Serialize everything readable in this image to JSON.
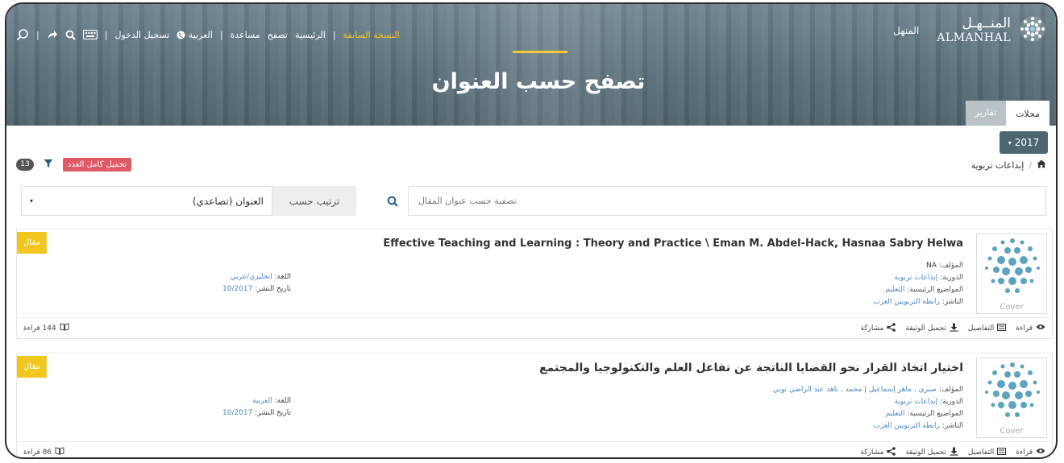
{
  "nav": {
    "items": [
      {
        "label": "النسخة السابقة",
        "active": true
      },
      {
        "label": "الرئيسية",
        "active": false
      },
      {
        "label": "تصفح",
        "active": false
      },
      {
        "label": "مساعدة",
        "active": false
      },
      {
        "label": "العربية",
        "active": false,
        "icon": "globe-icon"
      },
      {
        "label": "تسجيل الدخول",
        "active": false
      }
    ],
    "icons": [
      "search-icon",
      "share-arrow-icon",
      "search-icon",
      "keyboard-icon"
    ],
    "accent_color": "#f3c41d"
  },
  "brand": {
    "home_label": "المنهل",
    "logo_ar": "المنــهـل",
    "logo_en": "ALMANHAL"
  },
  "hero": {
    "title": "تصفح حسب العنوان"
  },
  "tabs": [
    {
      "label": "مجلات",
      "active": true
    },
    {
      "label": "تقارير",
      "active": false
    }
  ],
  "year_filter": {
    "label": "2017"
  },
  "breadcrumb": {
    "current": "إبداعات تربوية"
  },
  "results": {
    "count": "13",
    "download_all_label": "تحميل كامل العدد",
    "download_all_color": "#e05a66"
  },
  "search": {
    "placeholder": "تصفية حسب عنوان المقال"
  },
  "sort": {
    "label": "ترتيب حسب",
    "value": "العنوان (تصاعدي)"
  },
  "labels": {
    "author": "المؤلف:",
    "journal": "الدورية:",
    "subjects": "المواضيع الرئيسية:",
    "publisher": "الناشر:",
    "language": "اللغة:",
    "pub_date": "تاريخ النشر:",
    "read": "قراءة",
    "details": "التفاصيل",
    "download": "تحميل الوثيقة",
    "share": "مشاركة",
    "cover": "Cover"
  },
  "articles": [
    {
      "type": "مقال",
      "title": "Effective Teaching and Learning : Theory and Practice \\ Eman M. Abdel-Hack, Hasnaa Sabry Helwa",
      "author": "NA",
      "journal": "إبداعات تربوية",
      "subjects": "التعليم",
      "publisher": "رابطة التربويين العرب",
      "language": "انجليزي/عربي",
      "pub_date": "10/2017",
      "reads": "144 قراءة"
    },
    {
      "type": "مقال",
      "title": "اختيار اتخاذ القرار نحو القضايا الناتجة عن تفاعل العلم والتكنولوجيا والمجتمع",
      "author": "صبري ، ماهر إسماعيل | محمد ، ناهد عبد الراضي نوبي",
      "journal": "إبداعات تربوية",
      "subjects": "التعليم",
      "publisher": "رابطة التربويين العرب",
      "language": "العربية",
      "pub_date": "10/2017",
      "reads": "86 قراءة"
    }
  ]
}
